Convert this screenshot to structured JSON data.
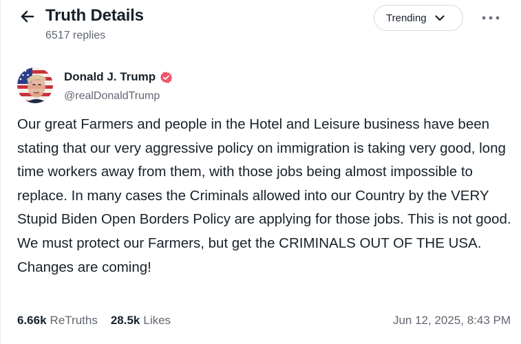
{
  "header": {
    "title": "Truth Details",
    "replies": "6517 replies",
    "sort_label": "Trending",
    "back_icon": "arrow-left-icon",
    "more_icon": "more-horizontal-icon"
  },
  "author": {
    "name": "Donald J. Trump",
    "handle": "@realDonaldTrump",
    "verified": true,
    "verified_color": "#f0566a"
  },
  "post": {
    "text": "Our great Farmers and people in the Hotel and Leisure business have been stating that our very aggressive policy on immigration is taking very good, long time workers away from them, with those jobs being almost impossible to replace. In many cases the Criminals allowed into our Country by the VERY Stupid Biden Open Borders Policy are applying for those jobs. This is not good. We must protect our Farmers, but get the CRIMINALS OUT OF THE USA. Changes are coming!",
    "retruths_count": "6.66k",
    "retruths_label": "ReTruths",
    "likes_count": "28.5k",
    "likes_label": "Likes",
    "timestamp": "Jun 12, 2025, 8:43 PM"
  }
}
